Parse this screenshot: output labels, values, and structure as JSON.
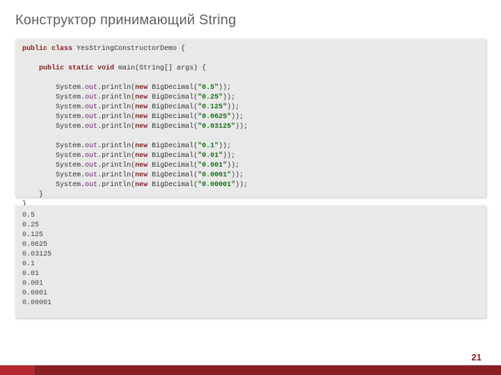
{
  "title": "Конструктор принимающий String",
  "page_number": "21",
  "code": {
    "class_decl_kw": "public class",
    "class_name": " YesStringConstructorDemo ",
    "main_kw": "public static void",
    "main_sig": " main(String[] args) ",
    "sys": "System",
    "out": "out",
    "pl": "println",
    "new_kw": "new",
    "bd": " BigDecimal(",
    "args": [
      "\"0.5\"",
      "\"0.25\"",
      "\"0.125\"",
      "\"0.0625\"",
      "\"0.03125\"",
      "\"0.1\"",
      "\"0.01\"",
      "\"0.001\"",
      "\"0.0001\"",
      "\"0.00001\""
    ]
  },
  "output_lines": [
    "0.5",
    "0.25",
    "0.125",
    "0.0625",
    "0.03125",
    "0.1",
    "0.01",
    "0.001",
    "0.0001",
    "0.00001"
  ]
}
